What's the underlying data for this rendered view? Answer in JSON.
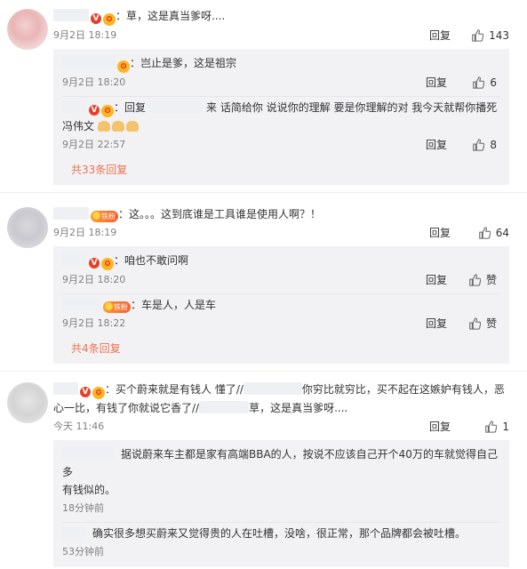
{
  "colors": {
    "link": "#eb7350",
    "vbadge": "#e6402b",
    "meta": "#808080",
    "subbg": "#f2f2f5"
  },
  "thread1": {
    "text": "：草，这是真当爹呀....",
    "time": "9月2日 18:19",
    "reply": "回复",
    "likes": "143",
    "subs": [
      {
        "text": "：岂止是爹，这是祖宗",
        "time": "9月2日 18:20",
        "reply": "回复",
        "likes": "6"
      },
      {
        "prefix": "：回复",
        "text": "来 话简给你 说说你的理解 要是你理解的对 我今天就帮你播死",
        "text2": "冯伟文",
        "time": "9月2日 22:57",
        "reply": "回复",
        "likes": "8"
      }
    ],
    "more": "共33条回复"
  },
  "thread2": {
    "text": "：这。。。这到底谁是工具谁是使用人啊？！",
    "time": "9月2日 18:19",
    "reply": "回复",
    "likes": "64",
    "fan_label": "铁粉",
    "subs": [
      {
        "text": "：咱也不敢问啊",
        "time": "9月2日 18:20",
        "reply": "回复",
        "likes": "赞"
      },
      {
        "text": "：车是人，人是车",
        "time": "9月2日 18:22",
        "reply": "回复",
        "likes": "赞"
      }
    ],
    "more": "共4条回复"
  },
  "thread3": {
    "text_a": "：买个蔚来就是有钱人 懂了//",
    "text_b": "你穷比就穷比，买不起在这嫉妒有钱人，恶",
    "text_c": "心一比，有钱了你就说它香了//",
    "text_d": "草，这是真当爹呀....",
    "time": "今天 11:46",
    "reply": "回复",
    "likes": "1",
    "subs": [
      {
        "text": "据说蔚来车主都是家有高端BBA的人，按说不应该自己开个40万的车就觉得自己多",
        "text2": "有钱似的。",
        "time": "18分钟前"
      },
      {
        "text": "确实很多想买蔚来又觉得贵的人在吐槽，没啥，很正常，那个品牌都会被吐槽。",
        "time": "53分钟前"
      }
    ]
  }
}
